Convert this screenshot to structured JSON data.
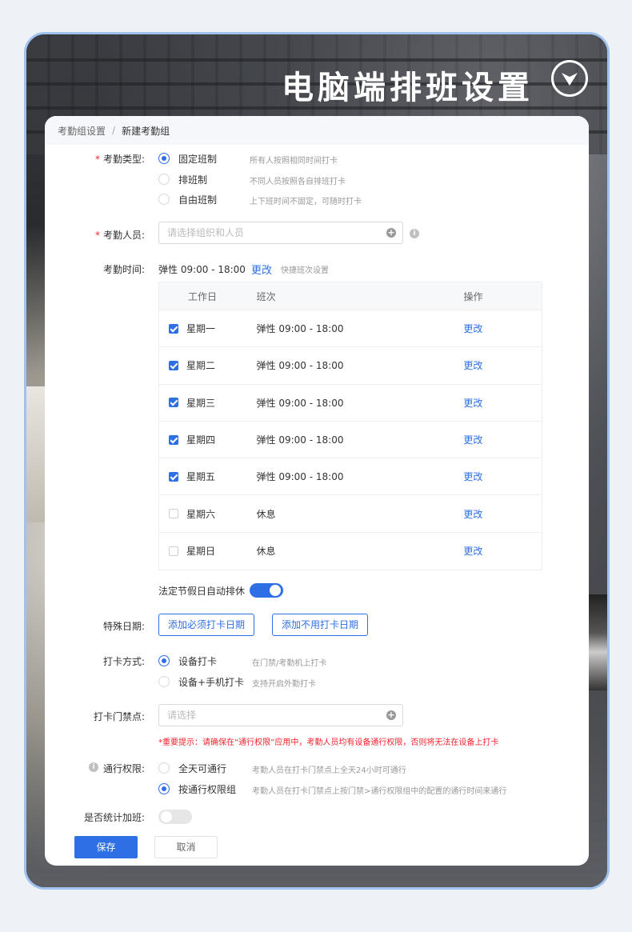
{
  "header": {
    "title": "电脑端排班设置",
    "icon": "chevron-down-circle-icon"
  },
  "breadcrumb": {
    "parent": "考勤组设置",
    "separator": "/",
    "current": "新建考勤组"
  },
  "attendance_type": {
    "label": "考勤类型:",
    "options": [
      {
        "label": "固定班制",
        "hint": "所有人按照相同时间打卡",
        "selected": true
      },
      {
        "label": "排班制",
        "hint": "不同人员按照各自排班打卡",
        "selected": false
      },
      {
        "label": "自由班制",
        "hint": "上下班时间不固定，可随时打卡",
        "selected": false
      }
    ]
  },
  "members": {
    "label": "考勤人员:",
    "placeholder": "请选择组织和人员"
  },
  "time": {
    "label": "考勤时间:",
    "value": "弹性 09:00 - 18:00",
    "change": "更改",
    "quick": "快捷班次设置",
    "columns": [
      "工作日",
      "班次",
      "操作"
    ],
    "rows": [
      {
        "day": "星期一",
        "shift": "弹性 09:00 - 18:00",
        "action": "更改",
        "checked": true
      },
      {
        "day": "星期二",
        "shift": "弹性 09:00 - 18:00",
        "action": "更改",
        "checked": true
      },
      {
        "day": "星期三",
        "shift": "弹性 09:00 - 18:00",
        "action": "更改",
        "checked": true
      },
      {
        "day": "星期四",
        "shift": "弹性 09:00 - 18:00",
        "action": "更改",
        "checked": true
      },
      {
        "day": "星期五",
        "shift": "弹性 09:00 - 18:00",
        "action": "更改",
        "checked": true
      },
      {
        "day": "星期六",
        "shift": "休息",
        "action": "更改",
        "checked": false
      },
      {
        "day": "星期日",
        "shift": "休息",
        "action": "更改",
        "checked": false
      }
    ]
  },
  "holiday": {
    "label": "法定节假日自动排休",
    "on": true
  },
  "special": {
    "label": "特殊日期:",
    "add_required": "添加必须打卡日期",
    "add_exempt": "添加不用打卡日期"
  },
  "punch_method": {
    "label": "打卡方式:",
    "options": [
      {
        "label": "设备打卡",
        "hint": "在门禁/考勤机上打卡",
        "selected": true
      },
      {
        "label": "设备+手机打卡",
        "hint": "支持开启外勤打卡",
        "selected": false
      }
    ]
  },
  "door": {
    "label": "打卡门禁点:",
    "placeholder": "请选择",
    "warning": "*重要提示：请确保在“通行权限”应用中，考勤人员均有设备通行权限，否则将无法在设备上打卡"
  },
  "access": {
    "label": "通行权限:",
    "options": [
      {
        "label": "全天可通行",
        "hint": "考勤人员在打卡门禁点上全天24小时可通行",
        "selected": false
      },
      {
        "label": "按通行权限组",
        "hint": "考勤人员在打卡门禁点上按门禁>通行权限组中的配置的通行时间来通行",
        "selected": true
      }
    ]
  },
  "overtime": {
    "label": "是否统计加班:",
    "on": false
  },
  "footer": {
    "save": "保存",
    "cancel": "取消"
  },
  "colors": {
    "primary": "#2f6fe6",
    "danger": "#f5222d",
    "frame": "#9fc3ee"
  }
}
